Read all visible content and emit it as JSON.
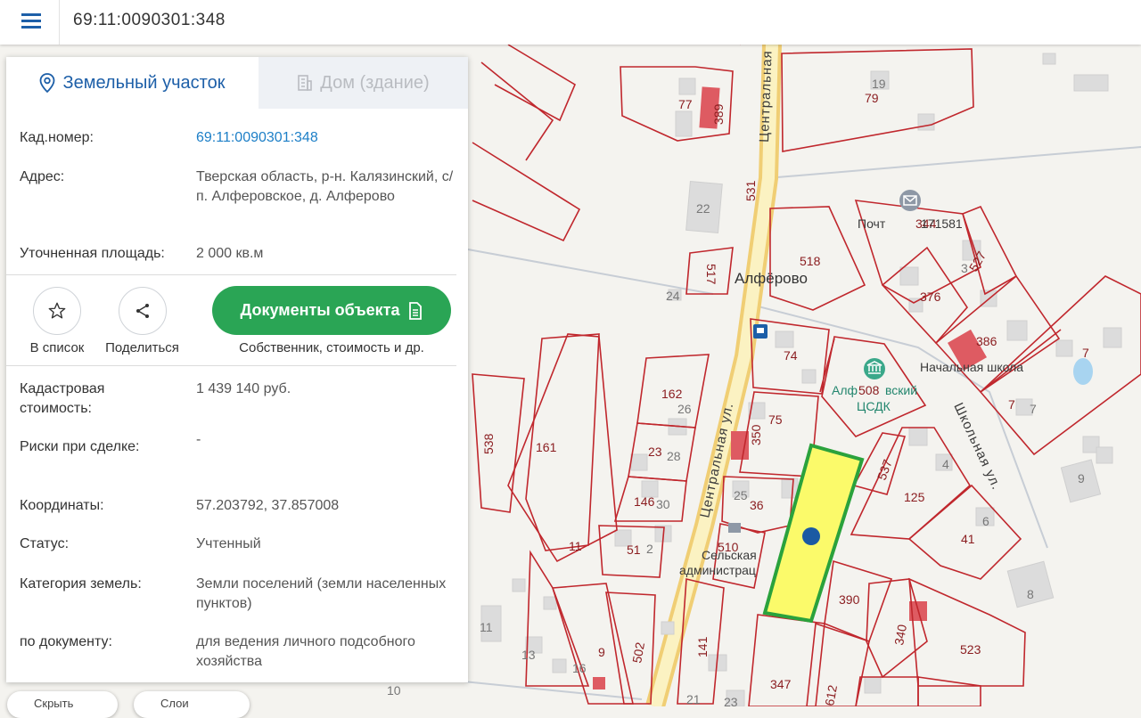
{
  "search": {
    "value": "69:11:0090301:348"
  },
  "tabs": [
    {
      "label": "Земельный участок",
      "icon": "location-pin-icon",
      "active": true
    },
    {
      "label": "Дом (здание)",
      "icon": "building-icon",
      "active": false
    }
  ],
  "info": {
    "cad_number": {
      "label": "Кад.номер:",
      "value": "69:11:0090301:348"
    },
    "address": {
      "label": "Адрес:",
      "value": "Тверская область, р-н. Калязинский, с/п. Алферовское, д. Алферово"
    },
    "area": {
      "label": "Уточненная площадь:",
      "value": "2 000 кв.м"
    },
    "cad_cost": {
      "label": "Кадастровая стоимость:",
      "value": "1 439 140 руб."
    },
    "risks": {
      "label": "Риски при сделке:",
      "value": "-"
    },
    "coords": {
      "label": "Координаты:",
      "value": "57.203792, 37.857008"
    },
    "status": {
      "label": "Статус:",
      "value": "Учтенный"
    },
    "category": {
      "label": "Категория земель:",
      "value": "Земли поселений (земли населенных пунктов)"
    },
    "by_doc": {
      "label": "по документу:",
      "value": "для ведения личного подсобного хозяйства"
    }
  },
  "actions": {
    "add_to_list": "В список",
    "share": "Поделиться",
    "documents": "Документы объекта",
    "documents_sub": "Собственник, стоимость и др."
  },
  "map": {
    "place_name": "Алфёрово",
    "streets": {
      "central_1": "Центральная",
      "central_2": "Центральная ул.",
      "school": "Школьная ул."
    },
    "pois": {
      "post": "Почт",
      "postcode": "171581",
      "school": "Начальная школа",
      "culture_1": "Алф",
      "culture_2": "вский",
      "culture_3": "ЦСДК",
      "admin_1": "Сельская",
      "admin_2": "администрац"
    },
    "parcel_labels": [
      "79",
      "19",
      "389",
      "77",
      "22",
      "531",
      "518",
      "344",
      "3",
      "527",
      "376",
      "386",
      "7",
      "7",
      "7",
      "517",
      "24",
      "74",
      "508",
      "162",
      "26",
      "75",
      "350",
      "23",
      "28",
      "537",
      "125",
      "4",
      "6",
      "41",
      "146",
      "30",
      "25",
      "36",
      "510",
      "51",
      "2",
      "11",
      "161",
      "538",
      "390",
      "340",
      "523",
      "141",
      "502",
      "9",
      "13",
      "16",
      "11",
      "10",
      "21",
      "23",
      "347",
      "612",
      "8",
      "9"
    ]
  },
  "bottom_controls": [
    "Скрыть",
    "Слои"
  ],
  "colors": {
    "brand": "#1d5fa8",
    "accent": "#2aa555",
    "parcel": "#c0272d",
    "selected_fill": "#fbfa6a",
    "selected_stroke": "#2aa23c"
  }
}
